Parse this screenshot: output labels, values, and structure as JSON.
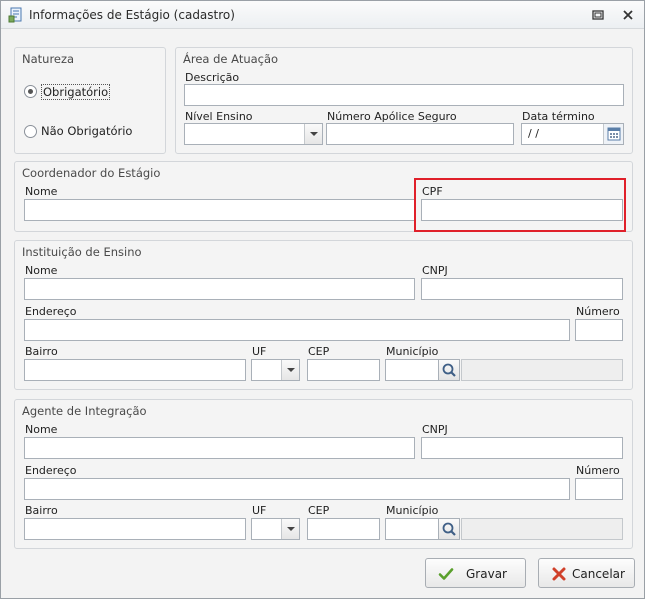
{
  "window": {
    "title": "Informações de Estágio (cadastro)"
  },
  "natureza": {
    "title": "Natureza",
    "options": [
      "Obrigatório",
      "Não Obrigatório"
    ],
    "selected": "Obrigatório"
  },
  "area": {
    "title": "Área de Atuação",
    "descricao_label": "Descrição",
    "descricao_value": "",
    "nivel_label": "Nível Ensino",
    "nivel_value": "",
    "apolice_label": "Número Apólice Seguro",
    "apolice_value": "",
    "data_label": "Data término",
    "data_value": " /  /"
  },
  "coordenador": {
    "title": "Coordenador do Estágio",
    "nome_label": "Nome",
    "cpf_label": "CPF"
  },
  "instituicao": {
    "title": "Instituição de Ensino",
    "nome_label": "Nome",
    "cnpj_label": "CNPJ",
    "endereco_label": "Endereço",
    "numero_label": "Número",
    "bairro_label": "Bairro",
    "uf_label": "UF",
    "cep_label": "CEP",
    "municipio_label": "Município"
  },
  "agente": {
    "title": "Agente de Integração",
    "nome_label": "Nome",
    "cnpj_label": "CNPJ",
    "endereco_label": "Endereço",
    "numero_label": "Número",
    "bairro_label": "Bairro",
    "uf_label": "UF",
    "cep_label": "CEP",
    "municipio_label": "Município"
  },
  "buttons": {
    "save": "Gravar",
    "cancel": "Cancelar"
  },
  "colors": {
    "highlight": "#e0202a",
    "save_icon": "#5aa02c",
    "cancel_icon": "#d0402a"
  }
}
